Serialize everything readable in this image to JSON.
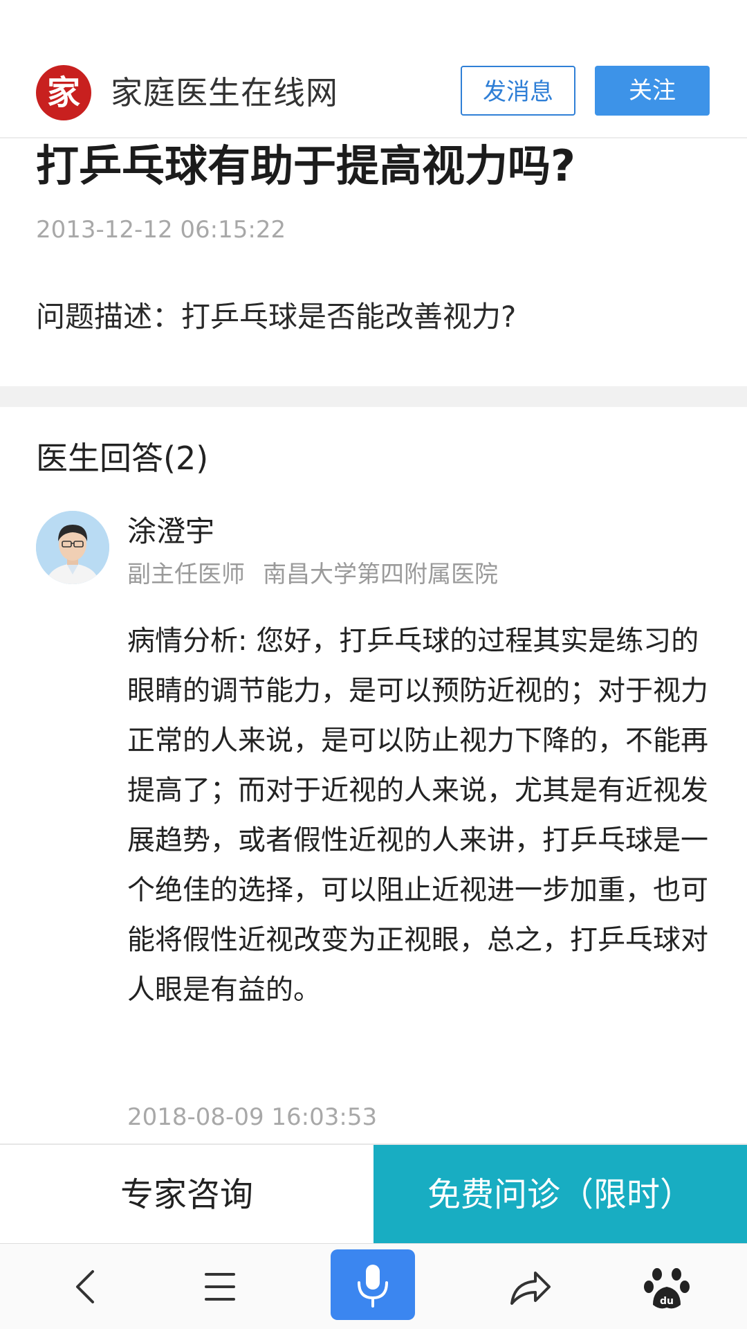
{
  "header": {
    "logo_char": "家",
    "site_name": "家庭医生在线网",
    "message_button": "发消息",
    "follow_button": "关注"
  },
  "question": {
    "title": "打乒乓球有助于提高视力吗?",
    "time": "2013-12-12 06:15:22",
    "description": "问题描述：打乒乓球是否能改善视力?"
  },
  "answers": {
    "heading": "医生回答(2)",
    "items": [
      {
        "doctor_name": "涂澄宇",
        "doctor_title": "副主任医师",
        "hospital": "南昌大学第四附属医院",
        "text": "病情分析: 您好，打乒乓球的过程其实是练习的眼睛的调节能力，是可以预防近视的；对于视力正常的人来说，是可以防止视力下降的，不能再提高了；而对于近视的人来说，尤其是有近视发展趋势，或者假性近视的人来讲，打乒乓球是一个绝佳的选择，可以阻止近视进一步加重，也可能将假性近视改变为正视眼，总之，打乒乓球对人眼是有益的。",
        "time": "2018-08-09 16:03:53"
      }
    ]
  },
  "actions": {
    "expert_label": "专家咨询",
    "free_label": "免费问诊（限时）"
  },
  "toolbar": {
    "icons": [
      "back-icon",
      "menu-icon",
      "microphone-icon",
      "share-icon",
      "baidu-paw-icon"
    ]
  },
  "colors": {
    "logo_red": "#c8201f",
    "follow_blue": "#3d93e8",
    "outline_blue": "#2f7fd6",
    "free_teal": "#18adc2",
    "voice_blue": "#3b86f0"
  }
}
